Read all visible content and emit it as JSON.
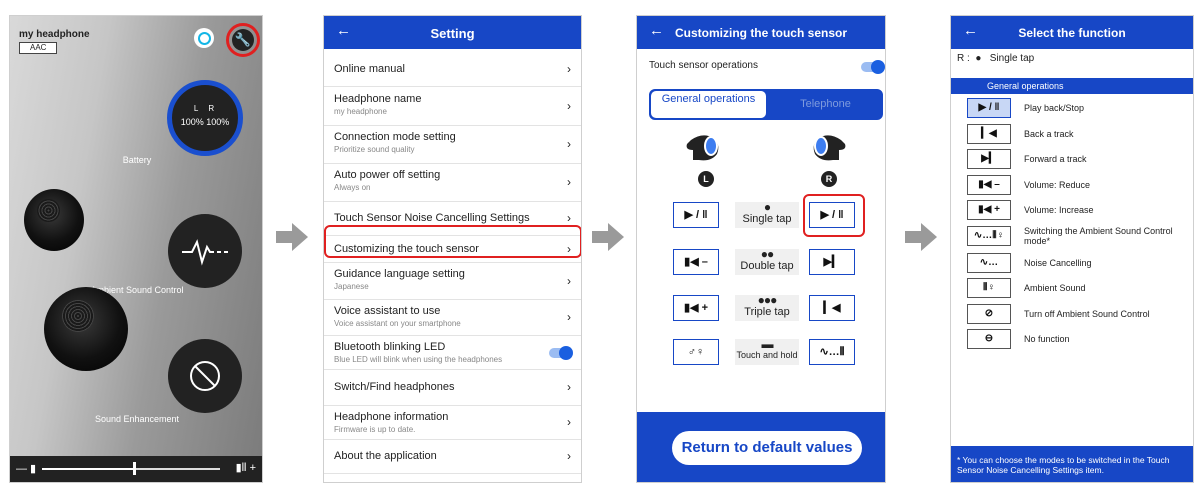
{
  "screen1": {
    "device_name": "my headphone",
    "codec": "AAC",
    "battery": {
      "left_label": "L",
      "right_label": "R",
      "left_value": "100",
      "right_value": "100",
      "unit": "%",
      "caption": "Battery"
    },
    "ambient_caption": "Ambient Sound Control",
    "enhancement_caption": "Sound Enhancement",
    "volume": {
      "down_icon": "— ▮",
      "up_icon": "▮⦀ +",
      "level": 0.52
    }
  },
  "screen2": {
    "title": "Setting",
    "back": "←",
    "rows": [
      {
        "title": "Online manual",
        "sub": ""
      },
      {
        "title": "Headphone name",
        "sub": "my headphone"
      },
      {
        "title": "Connection mode setting",
        "sub": "Prioritize sound quality"
      },
      {
        "title": "Auto power off setting",
        "sub": "Always on"
      },
      {
        "title": "Touch Sensor Noise Cancelling Settings",
        "sub": ""
      },
      {
        "title": "Customizing the touch sensor",
        "sub": ""
      },
      {
        "title": "Guidance language setting",
        "sub": "Japanese"
      },
      {
        "title": "Voice assistant to use",
        "sub": "Voice assistant on your smartphone"
      },
      {
        "title": "Bluetooth blinking LED",
        "sub": "Blue LED will blink when using the headphones"
      },
      {
        "title": "Switch/Find headphones",
        "sub": ""
      },
      {
        "title": "Headphone information",
        "sub": "Firmware is up to date."
      },
      {
        "title": "About the application",
        "sub": ""
      }
    ],
    "chevron": "›"
  },
  "screen3": {
    "title": "Customizing the touch sensor",
    "back": "←",
    "operations_label": "Touch sensor operations",
    "tab_general": "General operations",
    "tab_telephone": "Telephone",
    "left_label": "L",
    "right_label": "R",
    "gestures": [
      {
        "dots": "●",
        "label": "Single tap",
        "left": "▶ / ‖",
        "right": "▶ / ‖"
      },
      {
        "dots": "●●",
        "label": "Double tap",
        "left": "▮◀ –",
        "right": "▶▎"
      },
      {
        "dots": "●●●",
        "label": "Triple tap",
        "left": "▮◀ +",
        "right": "▎◀"
      },
      {
        "dots": "▬",
        "label": "Touch and hold",
        "left": "♂♀",
        "right": "∿…⦀"
      }
    ],
    "default_button": "Return to default values"
  },
  "screen4": {
    "title": "Select the function",
    "back": "←",
    "tap_prefix": "R :",
    "tap_dot": "●",
    "tap_label": "Single tap",
    "section": "General operations",
    "functions": [
      {
        "icon": "▶ / ‖",
        "label": "Play back/Stop"
      },
      {
        "icon": "▎◀",
        "label": "Back a track"
      },
      {
        "icon": "▶▎",
        "label": "Forward a track"
      },
      {
        "icon": "▮◀ –",
        "label": "Volume: Reduce"
      },
      {
        "icon": "▮◀ +",
        "label": "Volume: Increase"
      },
      {
        "icon": "∿…⦀♀",
        "label": "Switching the Ambient Sound Control mode*"
      },
      {
        "icon": "∿…",
        "label": "Noise Cancelling"
      },
      {
        "icon": "⦀♀",
        "label": "Ambient Sound"
      },
      {
        "icon": "⊘",
        "label": "Turn off Ambient Sound Control"
      },
      {
        "icon": "⊖",
        "label": "No function"
      }
    ],
    "note": "* You can choose the modes to be switched in the Touch Sensor Noise Cancelling Settings item."
  }
}
